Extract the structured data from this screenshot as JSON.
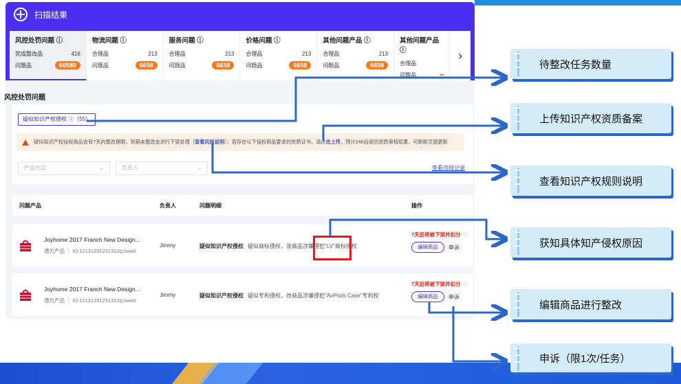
{
  "panel": {
    "title": "扫描结果",
    "cards": [
      {
        "title": "风控处罚问题 ⓘ",
        "row1_label": "完成整改品",
        "row1_value": "416",
        "row2_label": "问题品",
        "row2_value": "66580"
      },
      {
        "title": "物流问题 ⓘ",
        "row1_label": "合理品",
        "row1_value": "213",
        "row2_label": "问题品",
        "row2_value": "6658"
      },
      {
        "title": "服务问题 ⓘ",
        "row1_label": "合理品",
        "row1_value": "213",
        "row2_label": "问题品",
        "row2_value": "6658"
      },
      {
        "title": "价格问题 ⓘ",
        "row1_label": "合理品",
        "row1_value": "213",
        "row2_label": "问题品",
        "row2_value": "6658"
      },
      {
        "title": "其他问题产品 ⓘ",
        "row1_label": "合理品",
        "row1_value": "213",
        "row2_label": "问题品",
        "row2_value": "6658"
      },
      {
        "title": "其他问题产品 ⓘ",
        "row1_label": "合理品",
        "row1_value": "",
        "row2_label": "问题品",
        "row2_value": ""
      }
    ],
    "next": "›",
    "section_title": "风控处罚问题",
    "tag": "疑似知识产权侵权 ⓘ（55）",
    "warn": {
      "text1": "疑似知识产权侵权商品会有7天内整改期限，到期未整改会进行下架处理（",
      "link1": "查看风险说明",
      "text2": "）；若存在以下侵权商品要求的资质证书，请点",
      "link2": "击上传",
      "text3": "，预计24h后返回资质审核结果，可刷新页面更新"
    },
    "filter_category": "产品分层",
    "filter_owner": "负责人",
    "view_record": "查看违规记录",
    "table_head": {
      "product": "问题产品",
      "owner": "负责人",
      "issue": "问题明细",
      "action": "操作"
    },
    "rows": [
      {
        "name": "Joyhome 2017 Franch New Design...",
        "sub": "潜力产品 ｜ ID:12131231231312q1wwd",
        "owner": "Jimmy",
        "issue": "疑似知识产权侵权",
        "detail": "疑似商标侵权，该商品涉嫌侵犯\"LV\"商标侵权",
        "deadline": "7天后将被下架并扣分",
        "edit": "编辑商品",
        "appeal": "申诉"
      },
      {
        "name": "Joyhome 2017 Franch New Design...",
        "sub": "潜力产品 ｜ ID:12131231231312q1wwd",
        "owner": "Jimmy",
        "issue": "疑似知识产权侵权",
        "detail": "疑似专利侵权，改商品涉嫌侵犯\"AirPods Case\"专利权",
        "deadline": "7天后将被下架并扣分",
        "edit": "编辑商品",
        "appeal": "申诉"
      }
    ]
  },
  "callouts": [
    "待整改任务数量",
    "上传知识产权资质备案",
    "查看知识产权规则说明",
    "获知具体知产侵权原因",
    "编辑商品进行整改",
    "申诉（限1次/任务）"
  ],
  "colors": {
    "header": "#4b2ff1",
    "pill": "#ff7a1a",
    "arrow": "#2b66c9",
    "callout_bg": "#d4ecf8",
    "alert": "#e31a1a"
  }
}
